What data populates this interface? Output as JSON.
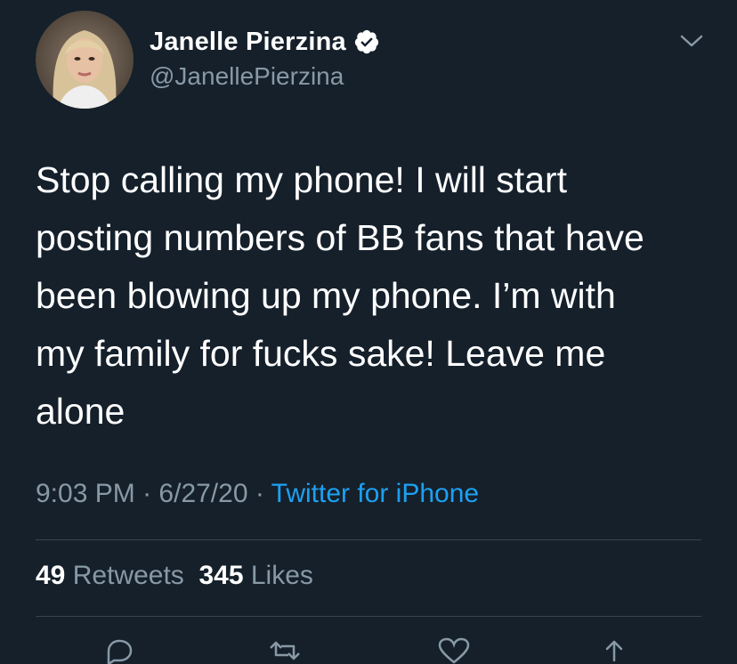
{
  "user": {
    "display_name": "Janelle Pierzina",
    "handle": "@JanellePierzina",
    "verified": true,
    "avatar_icon": "profile-photo"
  },
  "tweet": {
    "text": "Stop calling my phone! I will start\nposting numbers of BB fans that have\nbeen blowing up my phone. I’m with\nmy family for fucks sake! Leave me\nalone"
  },
  "meta": {
    "time": "9:03 PM",
    "separator": "·",
    "date": "6/27/20",
    "source": "Twitter for iPhone"
  },
  "stats": {
    "retweets_count": "49",
    "retweets_label": "Retweets",
    "likes_count": "345",
    "likes_label": "Likes"
  },
  "icons": {
    "caret": "chevron-down-icon",
    "reply": "reply-icon",
    "retweet": "retweet-icon",
    "like": "heart-icon",
    "share": "share-icon"
  },
  "colors": {
    "background": "#15202b",
    "secondary_text": "#8899a6",
    "link": "#1da1f2",
    "divider": "#38444d"
  }
}
